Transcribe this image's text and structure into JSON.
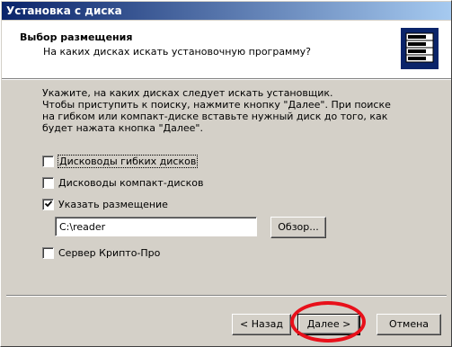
{
  "window": {
    "title": "Установка с диска"
  },
  "header": {
    "title": "Выбор размещения",
    "subtitle": "На каких дисках искать установочную программу?",
    "icon": "install-disk-icon"
  },
  "intro": {
    "lines": [
      "Укажите, на каких дисках следует искать установщик.",
      "Чтобы приступить к поиску, нажмите кнопку \"Далее\". При поиске",
      "на гибком или компакт-диске вставьте нужный диск до того, как",
      "будет нажата кнопка \"Далее\"."
    ]
  },
  "options": {
    "floppy": {
      "label": "Дисководы гибких дисков",
      "checked": false
    },
    "cdrom": {
      "label": "Дисководы компакт-дисков",
      "checked": false
    },
    "location": {
      "label": "Указать размещение",
      "checked": true
    },
    "crypto": {
      "label": "Сервер Крипто-Про",
      "checked": false
    }
  },
  "location_input": {
    "value": "C:\\reader"
  },
  "buttons": {
    "browse": "Обзор...",
    "back": "< Назад",
    "next": "Далее >",
    "cancel": "Отмена"
  },
  "colors": {
    "titlebar_start": "#0a246a",
    "titlebar_end": "#a6caf0",
    "face": "#d4d0c8",
    "highlight_ring": "#e8101a"
  }
}
